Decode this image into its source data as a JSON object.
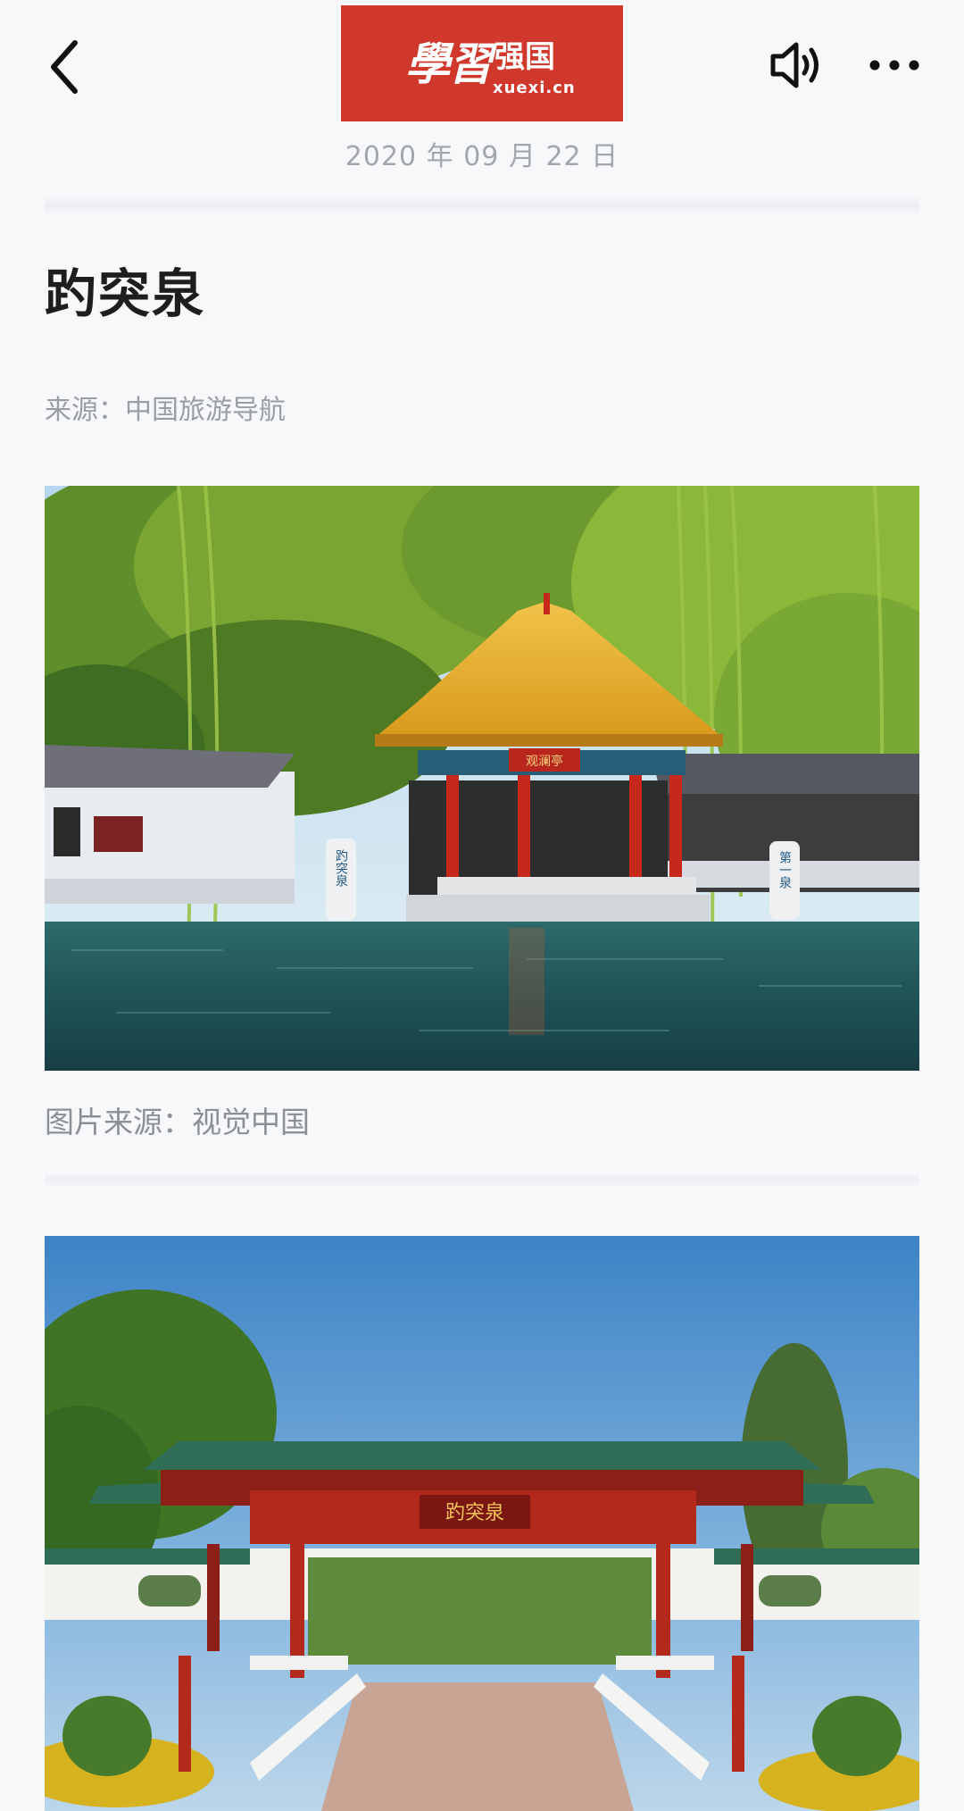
{
  "header": {
    "back_icon": "chevron-left-icon",
    "logo_calligraphy": "學習",
    "logo_text": "强国",
    "logo_subtext": "xuexi.cn",
    "logo_color": "#d0382b",
    "speaker_icon": "speaker-icon",
    "more_icon": "more-horizontal-icon"
  },
  "article": {
    "date": "2020 年 09 月 22 日",
    "title": "趵突泉",
    "source": "来源：中国旅游导航",
    "image1_caption": "图片来源：视觉中国",
    "image1_signs": {
      "left_stele": "趵突泉",
      "right_stele": "第一泉",
      "pavilion_plaque": "观澜亭"
    },
    "image2_plaque": "趵突泉"
  }
}
